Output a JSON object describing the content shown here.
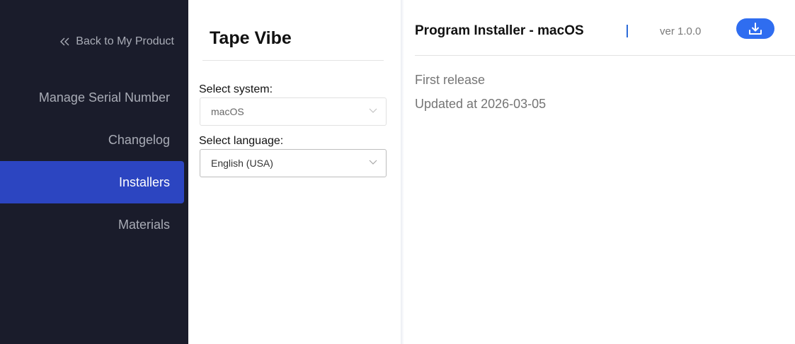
{
  "sidebar": {
    "back_label": "Back to My Product",
    "back_icon": "double-chevron-left-icon",
    "items": [
      {
        "label": "Manage Serial Number",
        "active": false
      },
      {
        "label": "Changelog",
        "active": false
      },
      {
        "label": "Installers",
        "active": true
      },
      {
        "label": "Materials",
        "active": false
      }
    ]
  },
  "selector": {
    "product_name": "Tape Vibe",
    "system_label": "Select system:",
    "system_value": "macOS",
    "language_label": "Select language:",
    "language_value": "English (USA)"
  },
  "installer": {
    "title": "Program Installer - macOS",
    "version": "ver 1.0.0",
    "download_icon": "download-icon",
    "release_note": "First release",
    "updated_at": "Updated at 2026-03-05"
  },
  "colors": {
    "sidebar_bg": "#1a1c2b",
    "sidebar_active": "#2c45c1",
    "accent_blue": "#2f6df0"
  }
}
